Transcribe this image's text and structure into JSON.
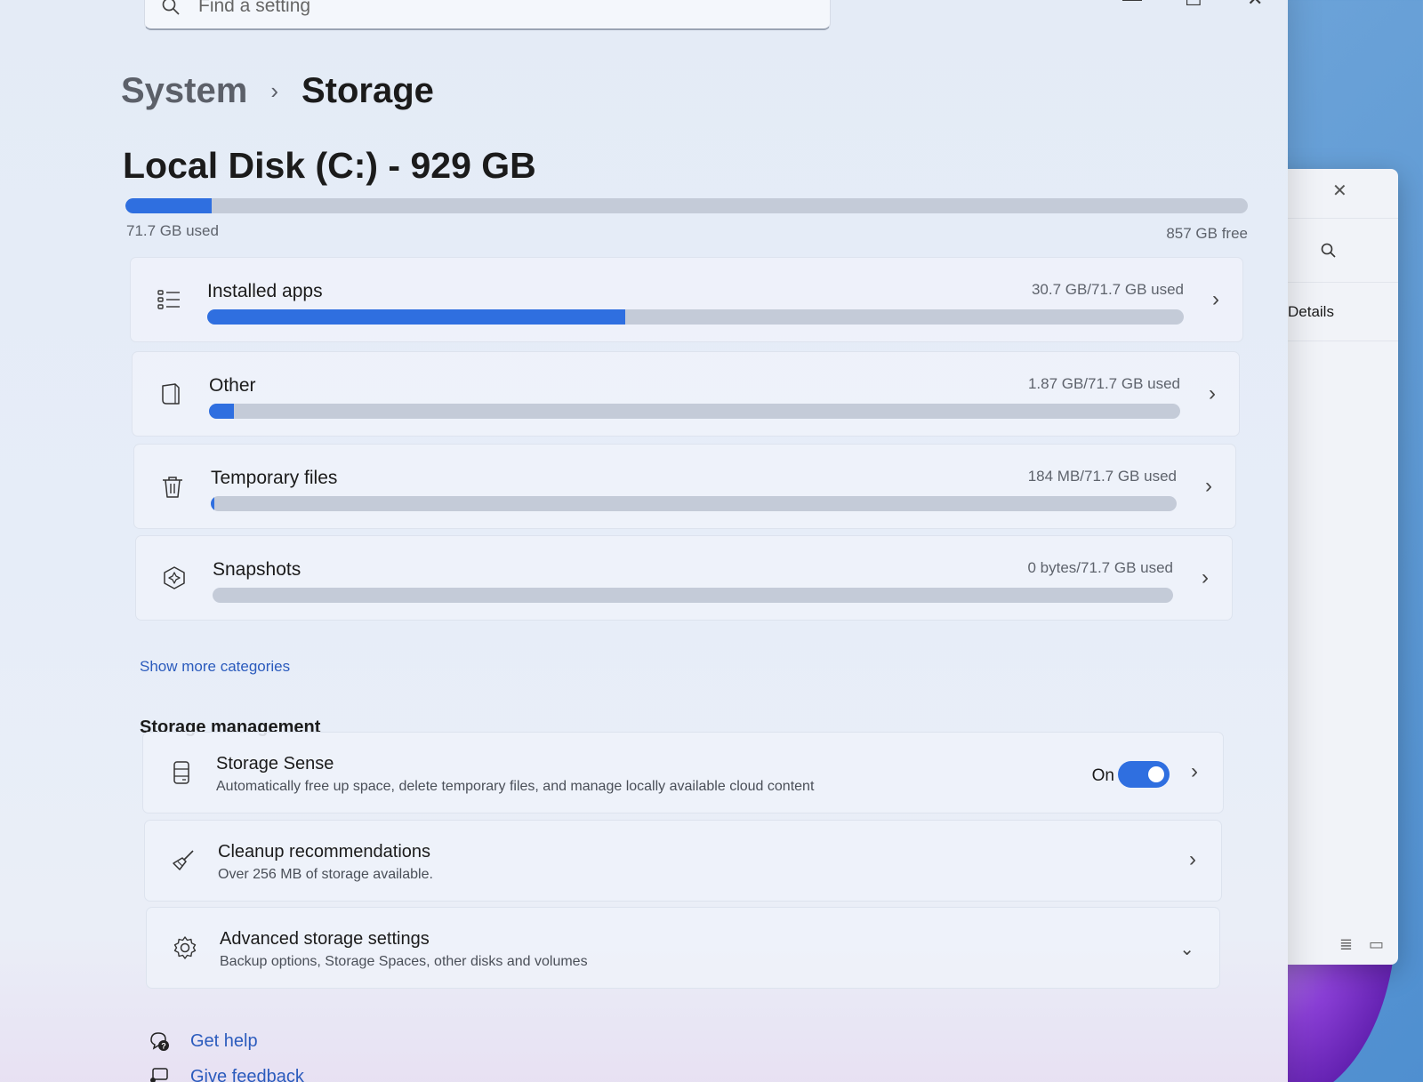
{
  "search": {
    "placeholder": "Find a setting"
  },
  "breadcrumb": {
    "parent": "System",
    "separator": "›",
    "current": "Storage"
  },
  "disk": {
    "title": "Local Disk (C:) - 929 GB",
    "used_label": "71.7 GB used",
    "free_label": "857 GB free",
    "used_fraction": 0.077
  },
  "categories": [
    {
      "name": "Installed apps",
      "size": "30.7 GB/71.7 GB used",
      "fraction": 0.428,
      "icon": "list-icon"
    },
    {
      "name": "Other",
      "size": "1.87 GB/71.7 GB used",
      "fraction": 0.026,
      "icon": "document-icon"
    },
    {
      "name": "Temporary files",
      "size": "184 MB/71.7 GB used",
      "fraction": 0.003,
      "icon": "trash-icon"
    },
    {
      "name": "Snapshots",
      "size": "0 bytes/71.7 GB used",
      "fraction": 0,
      "icon": "snapshot-icon"
    }
  ],
  "show_more": "Show more categories",
  "management": {
    "heading": "Storage management",
    "items": [
      {
        "title": "Storage Sense",
        "subtitle": "Automatically free up space, delete temporary files, and manage locally available cloud content",
        "toggle_label": "On",
        "toggle_on": true,
        "icon": "drive-icon"
      },
      {
        "title": "Cleanup recommendations",
        "subtitle": "Over 256 MB of storage available.",
        "icon": "broom-icon"
      },
      {
        "title": "Advanced storage settings",
        "subtitle": "Backup options, Storage Spaces, other disks and volumes",
        "icon": "gear-icon"
      }
    ]
  },
  "footer": {
    "help": "Get help",
    "feedback": "Give feedback"
  },
  "background_window": {
    "details_label": "Details"
  },
  "colors": {
    "accent": "#2f6fe0",
    "link": "#2b5bbd"
  }
}
